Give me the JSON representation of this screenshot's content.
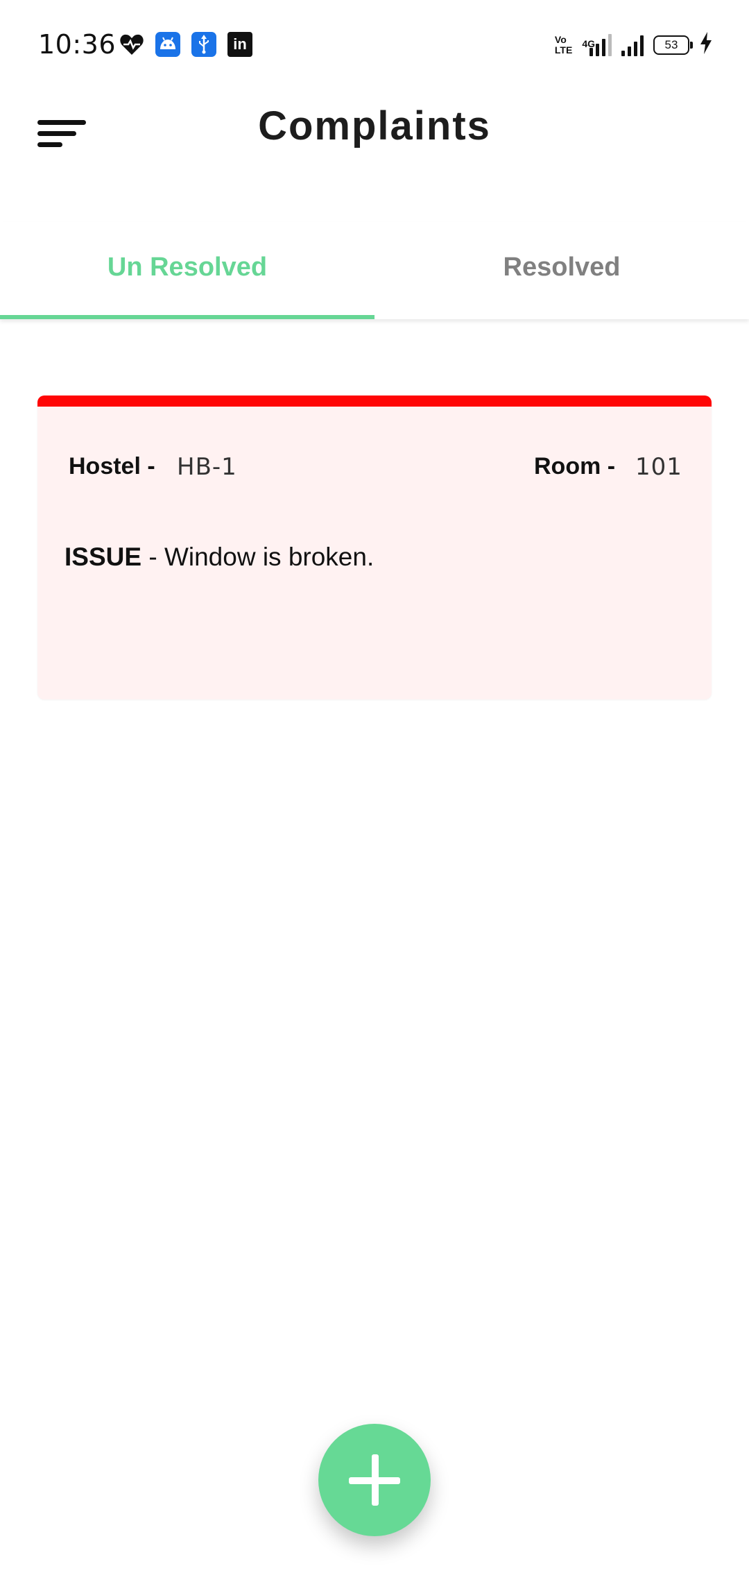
{
  "status_bar": {
    "time": "10:36",
    "notification_icons": [
      "heart-icon",
      "android-icon",
      "usb-icon",
      "linkedin-icon"
    ],
    "linkedin_glyph": "in",
    "volte_top": "Vo",
    "volte_bottom": "LTE",
    "network_type": "4G",
    "battery_level": "53"
  },
  "app_bar": {
    "title": "Complaints"
  },
  "tabs": [
    {
      "label": "Un Resolved",
      "active": true
    },
    {
      "label": "Resolved",
      "active": false
    }
  ],
  "complaints": [
    {
      "hostel_label": "Hostel -",
      "hostel_value": "HB-1",
      "room_label": "Room -",
      "room_value": "101",
      "issue_label": "ISSUE",
      "issue_separator": " - ",
      "issue_text": "Window is broken."
    }
  ],
  "colors": {
    "accent": "#66d695",
    "card_top_bar": "#ff0606",
    "card_background": "#fff2f2",
    "inactive_tab": "#808080"
  }
}
